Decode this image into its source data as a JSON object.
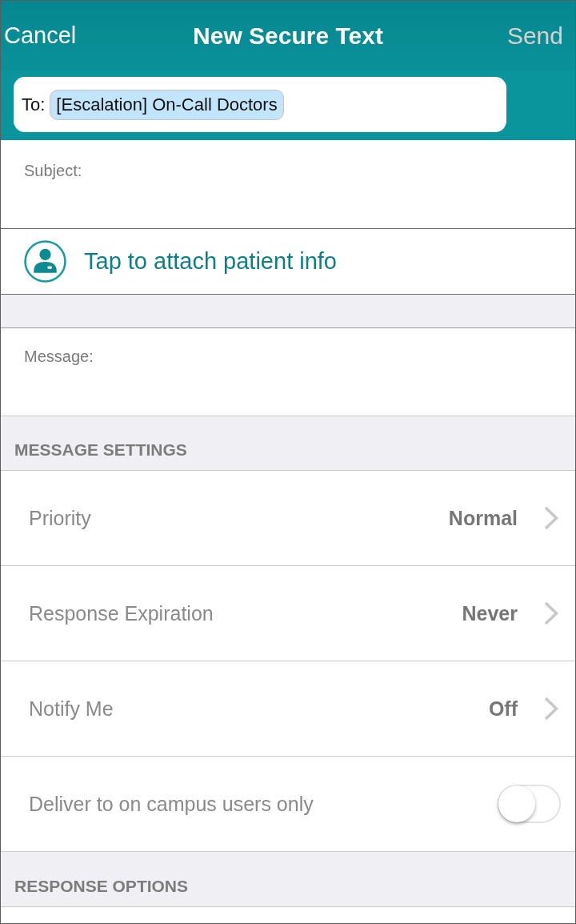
{
  "nav_bar": {
    "cancel": "Cancel",
    "title": "New Secure Text",
    "send": {
      "label": "Send",
      "disabled": true
    }
  },
  "recipients": {
    "label": "To:",
    "tokens": [
      "[Escalation] On-Call Doctors"
    ]
  },
  "subject": {
    "placeholder": "Subject:"
  },
  "attach": {
    "label": "Tap to attach patient info"
  },
  "message": {
    "placeholder": "Message:"
  },
  "sections": [
    {
      "title": "MESSAGE SETTINGS",
      "rows": [
        {
          "kind": "disclosure",
          "label": "Priority",
          "value": "Normal"
        },
        {
          "kind": "disclosure",
          "label": "Response Expiration",
          "value": "Never"
        },
        {
          "kind": "disclosure",
          "label": "Notify Me",
          "value": "Off"
        },
        {
          "kind": "toggle",
          "label": "Deliver to on campus users only",
          "on": false
        }
      ]
    },
    {
      "title": "RESPONSE OPTIONS"
    }
  ]
}
